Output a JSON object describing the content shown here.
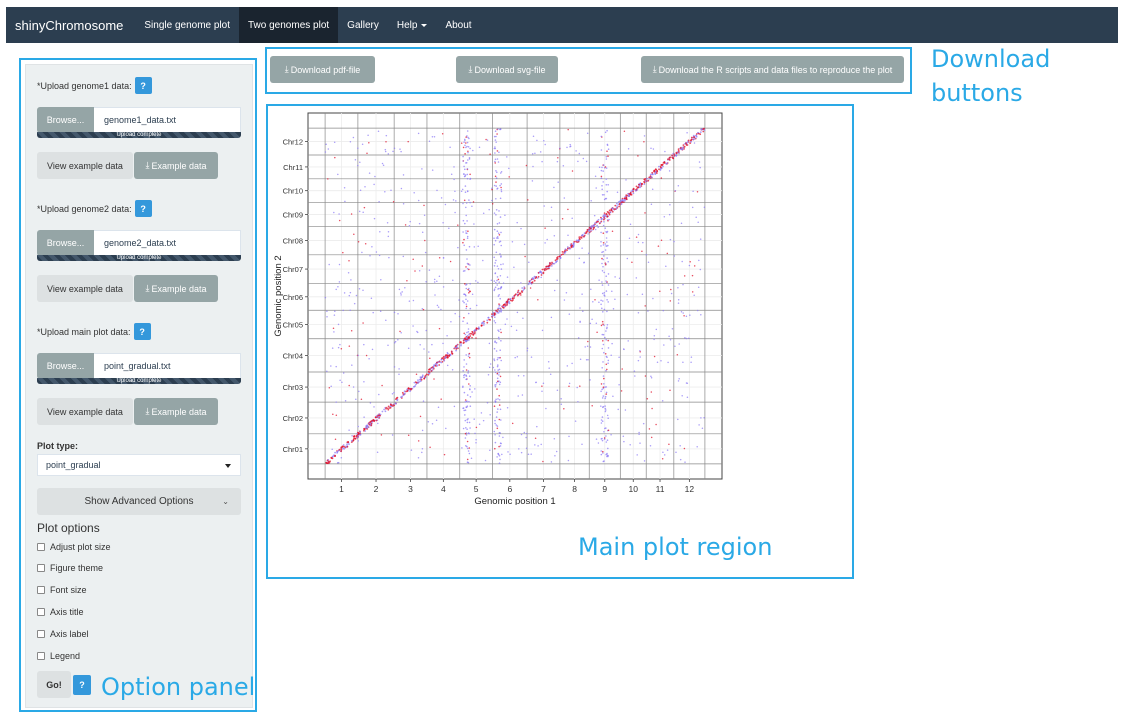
{
  "navbar": {
    "brand": "shinyChromosome",
    "items": [
      {
        "label": "Single genome plot",
        "active": false
      },
      {
        "label": "Two genomes plot",
        "active": true
      },
      {
        "label": "Gallery",
        "active": false
      },
      {
        "label": "Help",
        "active": false,
        "dropdown": true
      },
      {
        "label": "About",
        "active": false
      }
    ]
  },
  "annotations": {
    "download": "Download buttons",
    "download_line1": "Download",
    "download_line2": "buttons",
    "main_plot": "Main plot region",
    "option_panel": "Option panel"
  },
  "downloads": {
    "pdf": "Download pdf-file",
    "svg": "Download svg-file",
    "scripts": "Download the R scripts and data files to reproduce the plot",
    "icon": "download-icon"
  },
  "panel": {
    "uploads": [
      {
        "label": "*Upload genome1 data:",
        "help": "?",
        "browse": "Browse...",
        "file": "genome1_data.txt",
        "status": "Upload complete",
        "view": "View example data",
        "example": "Example data"
      },
      {
        "label": "*Upload genome2 data:",
        "help": "?",
        "browse": "Browse...",
        "file": "genome2_data.txt",
        "status": "Upload complete",
        "view": "View example data",
        "example": "Example data"
      },
      {
        "label": "*Upload main plot data:",
        "help": "?",
        "browse": "Browse...",
        "file": "point_gradual.txt",
        "status": "Upload complete",
        "view": "View example data",
        "example": "Example data"
      }
    ],
    "plot_type_label": "Plot type:",
    "plot_type_value": "point_gradual",
    "advanced": "Show Advanced Options",
    "plot_options_title": "Plot options",
    "options": [
      "Adjust plot size",
      "Figure theme",
      "Font size",
      "Axis title",
      "Axis label",
      "Legend"
    ],
    "go": "Go!",
    "go_help": "?"
  },
  "colors": {
    "navbar": "#2c3e50",
    "accent": "#2aa9e6",
    "help": "#3498db",
    "button": "#95a5a6",
    "point_high": "#e0102a",
    "point_low": "#8d7cf5"
  },
  "chart_data": {
    "type": "scatter",
    "title": "",
    "xlabel": "Genomic position 1",
    "ylabel": "Genomic position 2",
    "x_ticks": [
      "1",
      "2",
      "3",
      "4",
      "5",
      "6",
      "7",
      "8",
      "9",
      "10",
      "11",
      "12"
    ],
    "y_ticks": [
      "Chr01",
      "Chr02",
      "Chr03",
      "Chr04",
      "Chr05",
      "Chr06",
      "Chr07",
      "Chr08",
      "Chr09",
      "Chr10",
      "Chr11",
      "Chr12"
    ],
    "x_chrom_boundaries": [
      0,
      0.95,
      2.0,
      2.95,
      3.9,
      4.85,
      5.85,
      6.8,
      7.65,
      8.55,
      9.3,
      10.1,
      11.0
    ],
    "y_chrom_boundaries": [
      0,
      0.95,
      1.95,
      2.9,
      3.95,
      4.85,
      5.7,
      6.6,
      7.5,
      8.25,
      9.0,
      9.75,
      10.6
    ],
    "grid": true,
    "diagonal_density": "dense",
    "vertical_bands_near_x": [
      4.1,
      5.0,
      8.1
    ],
    "color_gradient": [
      "#8d7cf5",
      "#e0102a"
    ]
  }
}
